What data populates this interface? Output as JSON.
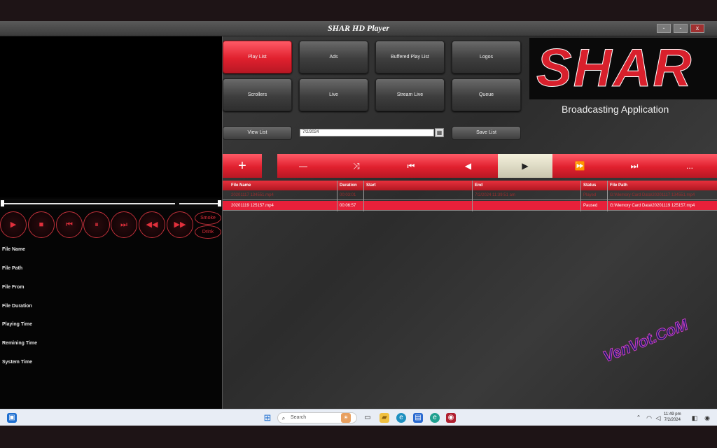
{
  "window": {
    "title": "SHAR HD Player",
    "min_label": "-",
    "max_label": "-",
    "close_label": "x"
  },
  "player_controls": {
    "play": "▶",
    "stop": "■",
    "prev": "⏮",
    "pause": "⏸",
    "next": "⏭",
    "rewind": "◀◀",
    "forward": "▶▶",
    "smoke_label": "Smoke",
    "drink_label": "Drink"
  },
  "info_labels": [
    "File Name",
    "File Path",
    "File From",
    "File Duration",
    "Playing Time",
    "Remining Time",
    "System Time"
  ],
  "tabs": {
    "play_list": "Play List",
    "ads": "Ads",
    "buffered_play_list": "Buffered Play List",
    "logos": "Logos",
    "scrollers": "Scrollers",
    "live": "Live",
    "stream_live": "Stream Live",
    "queue": "Queue"
  },
  "list_controls": {
    "view_list": "View List",
    "date_value": "7/2/2024",
    "save_list": "Save List"
  },
  "logo": {
    "word": "SHAR",
    "tagline": "Broadcasting Application"
  },
  "transport": {
    "add": "+",
    "remove": "—",
    "shuffle": "⤨",
    "first": "⏮",
    "back": "◀",
    "play": "▶",
    "forward": "⏩",
    "last": "⏭",
    "more": "..."
  },
  "grid": {
    "columns": [
      "File Name",
      "Duration",
      "Start",
      "End",
      "Status",
      "File Path"
    ],
    "rows": [
      {
        "file_name": "20201117 134551.mp4",
        "duration": "00:03:01",
        "start": "",
        "end": "7/2/2024 11:39:51 am",
        "status": "Played",
        "file_path": "G:\\Memory Card Data\\20201117 134551.mp4"
      },
      {
        "file_name": "20201119 125157.mp4",
        "duration": "00:06:57",
        "start": "",
        "end": "",
        "status": "Paused",
        "file_path": "G:\\Memory Card Data\\20201119 125157.mp4"
      }
    ]
  },
  "watermark": "VenVot.CoM",
  "taskbar": {
    "search_placeholder": "Search",
    "time": "11:49 pm",
    "date": "7/2/2024"
  },
  "colors": {
    "accent_red": "#e0202e",
    "highlight_cream": "#f4f1dc"
  }
}
